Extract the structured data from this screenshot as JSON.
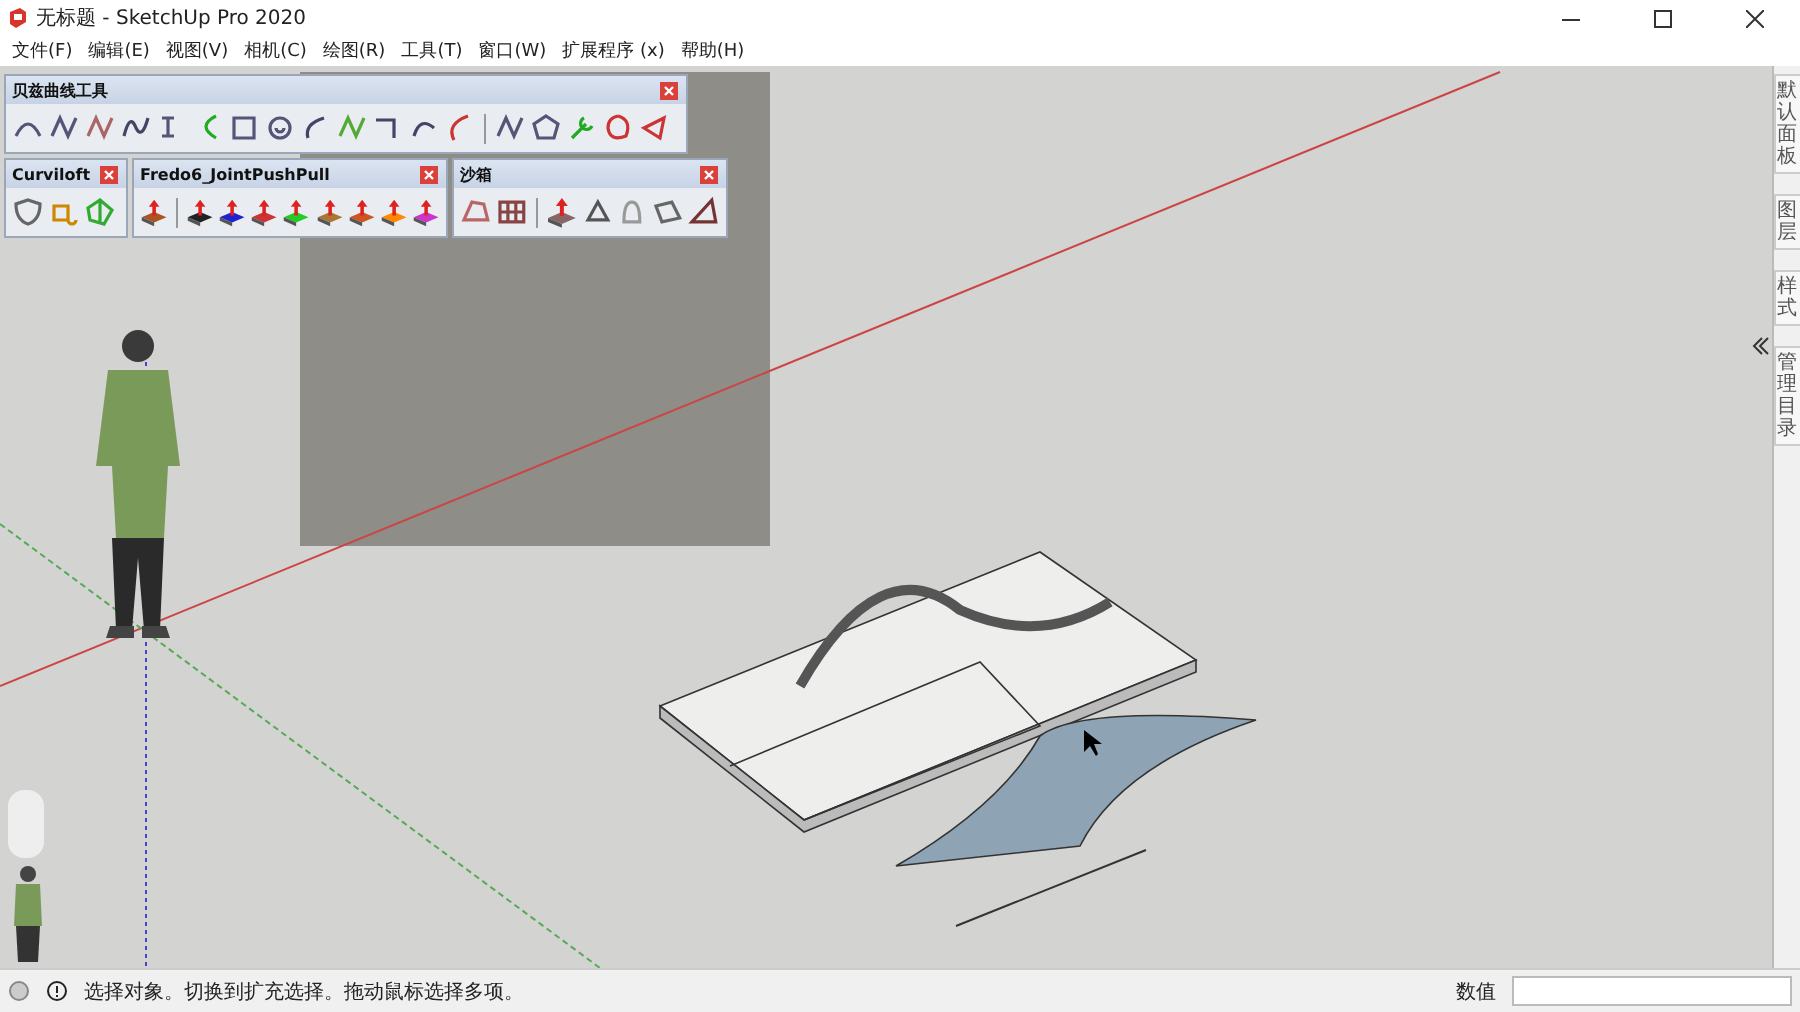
{
  "window": {
    "title": "无标题 - SketchUp Pro 2020"
  },
  "menu": [
    {
      "label": "文件(F)"
    },
    {
      "label": "编辑(E)"
    },
    {
      "label": "视图(V)"
    },
    {
      "label": "相机(C)"
    },
    {
      "label": "绘图(R)"
    },
    {
      "label": "工具(T)"
    },
    {
      "label": "窗口(W)"
    },
    {
      "label": "扩展程序 (x)"
    },
    {
      "label": "帮助(H)"
    }
  ],
  "toolbars": [
    {
      "title": "贝兹曲线工具",
      "kind": "bezier"
    },
    {
      "title": "Curviloft",
      "kind": "curviloft"
    },
    {
      "title": "Fredo6_JointPushPull",
      "kind": "pushpull"
    },
    {
      "title": "沙箱",
      "kind": "sandbox"
    }
  ],
  "tray_tabs": [
    {
      "label": "默认面板"
    },
    {
      "label": "图层"
    },
    {
      "label": "样式"
    },
    {
      "label": "管理目录"
    }
  ],
  "status_bar": {
    "message": "选择对象。切换到扩充选择。拖动鼠标选择多项。",
    "measurements_label": "数值"
  }
}
